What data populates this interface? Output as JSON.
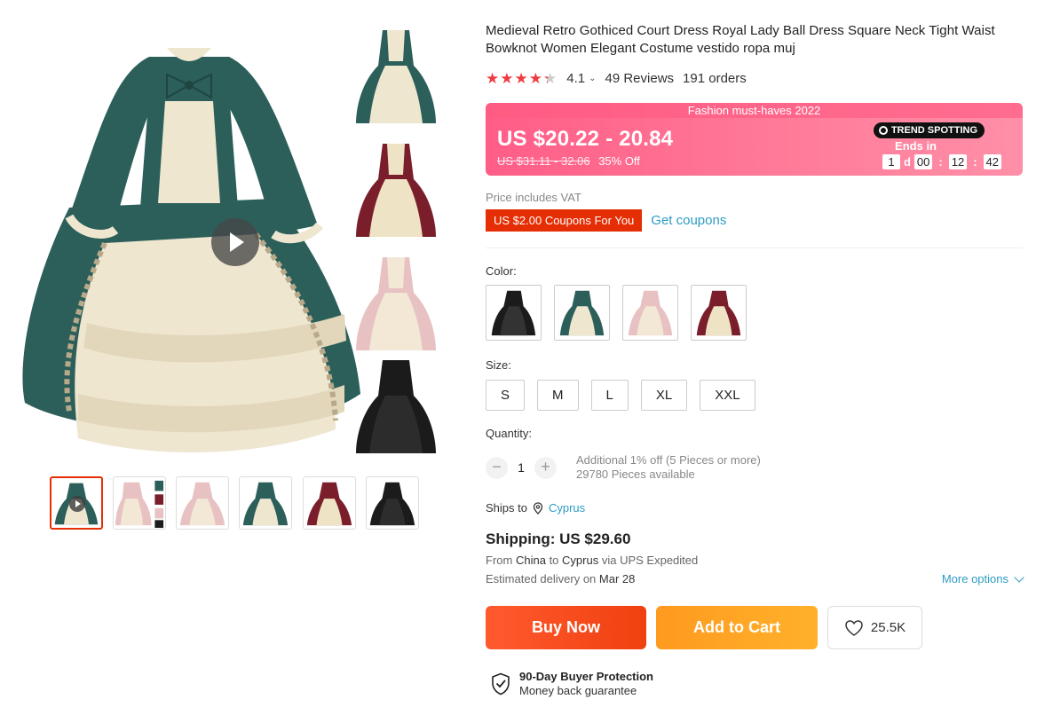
{
  "product": {
    "title": "Medieval Retro Gothiced Court Dress Royal Lady Ball Dress Square Neck Tight Waist Bowknot Women Elegant Costume vestido ropa muj",
    "rating": "4.1",
    "reviews": "49 Reviews",
    "orders": "191 orders"
  },
  "price": {
    "banner": "Fashion must-haves 2022",
    "current": "US $20.22 - 20.84",
    "original": "US $31.11 - 32.06",
    "discount": "35% Off",
    "badge": "TREND SPOTTING",
    "ends_in": "Ends in",
    "countdown": {
      "days": "1",
      "d_label": "d",
      "hours": "00",
      "minutes": "12",
      "seconds": "42"
    },
    "vat_note": "Price includes VAT",
    "coupon": "US $2.00 Coupons For You",
    "get_coupons": "Get coupons"
  },
  "options": {
    "color_label": "Color:",
    "colors": [
      "black-dress",
      "teal-dress",
      "pink-dress",
      "burgundy-dress"
    ],
    "size_label": "Size:",
    "sizes": [
      "S",
      "M",
      "L",
      "XL",
      "XXL"
    ],
    "quantity_label": "Quantity:",
    "quantity": "1",
    "qty_minus": "−",
    "qty_plus": "+",
    "qty_note1": "Additional 1% off (5 Pieces or more)",
    "qty_note2": "29780 Pieces available"
  },
  "shipping": {
    "ships_to_label": "Ships to",
    "country": "Cyprus",
    "cost": "Shipping: US $29.60",
    "from_prefix": "From",
    "from": "China",
    "to_prefix": "to",
    "to": "Cyprus",
    "via": "via UPS Expedited",
    "est_prefix": "Estimated delivery on",
    "est_date": "Mar 28",
    "more_options": "More options"
  },
  "actions": {
    "buy_now": "Buy Now",
    "add_to_cart": "Add to Cart",
    "wishlist_count": "25.5K"
  },
  "protection": {
    "title": "90-Day Buyer Protection",
    "subtitle": "Money back guarantee"
  },
  "colors": {
    "accent_red": "#e62e04",
    "price_pink": "#ff6b8e",
    "link_blue": "#2e9cc3",
    "buy_orange": "#f34a1e",
    "cart_orange": "#ffa424",
    "star_red": "#f03b42"
  }
}
